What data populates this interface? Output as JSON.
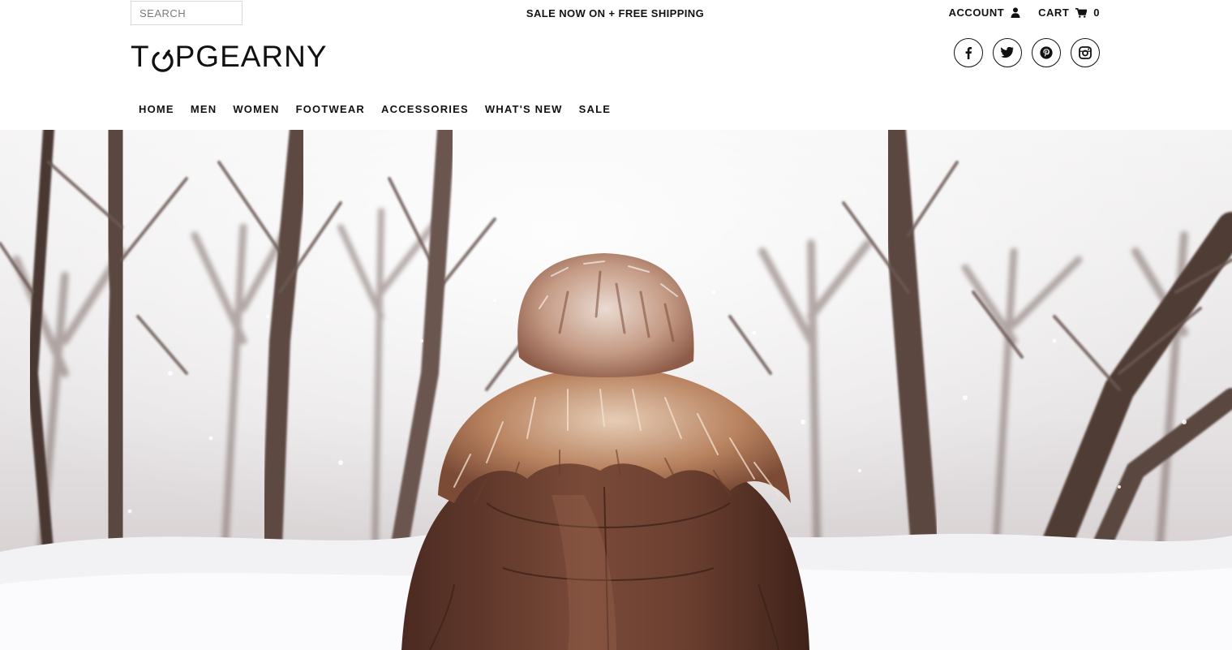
{
  "topbar": {
    "search_placeholder": "SEARCH",
    "promo_text": "SALE NOW ON + FREE SHIPPING",
    "account_label": "ACCOUNT",
    "cart_label": "CART",
    "cart_count": "0"
  },
  "brand": {
    "logo_prefix": "T",
    "logo_suffix": "PGEARNY"
  },
  "social": [
    "facebook-icon",
    "twitter-icon",
    "pinterest-icon",
    "instagram-icon"
  ],
  "nav": {
    "items": [
      "HOME",
      "MEN",
      "WOMEN",
      "FOOTWEAR",
      "ACCESSORIES",
      "WHAT'S NEW",
      "SALE"
    ]
  },
  "hero": {
    "image_subject": "person in fur-hooded brown jacket walking in a snowy forest"
  },
  "colors": {
    "text": "#111111",
    "border": "#d9d9d9",
    "jacket": "#6e3f2e",
    "fur": "#b98965",
    "sky": "#f1f0f0",
    "snow": "#f4f4f6"
  }
}
